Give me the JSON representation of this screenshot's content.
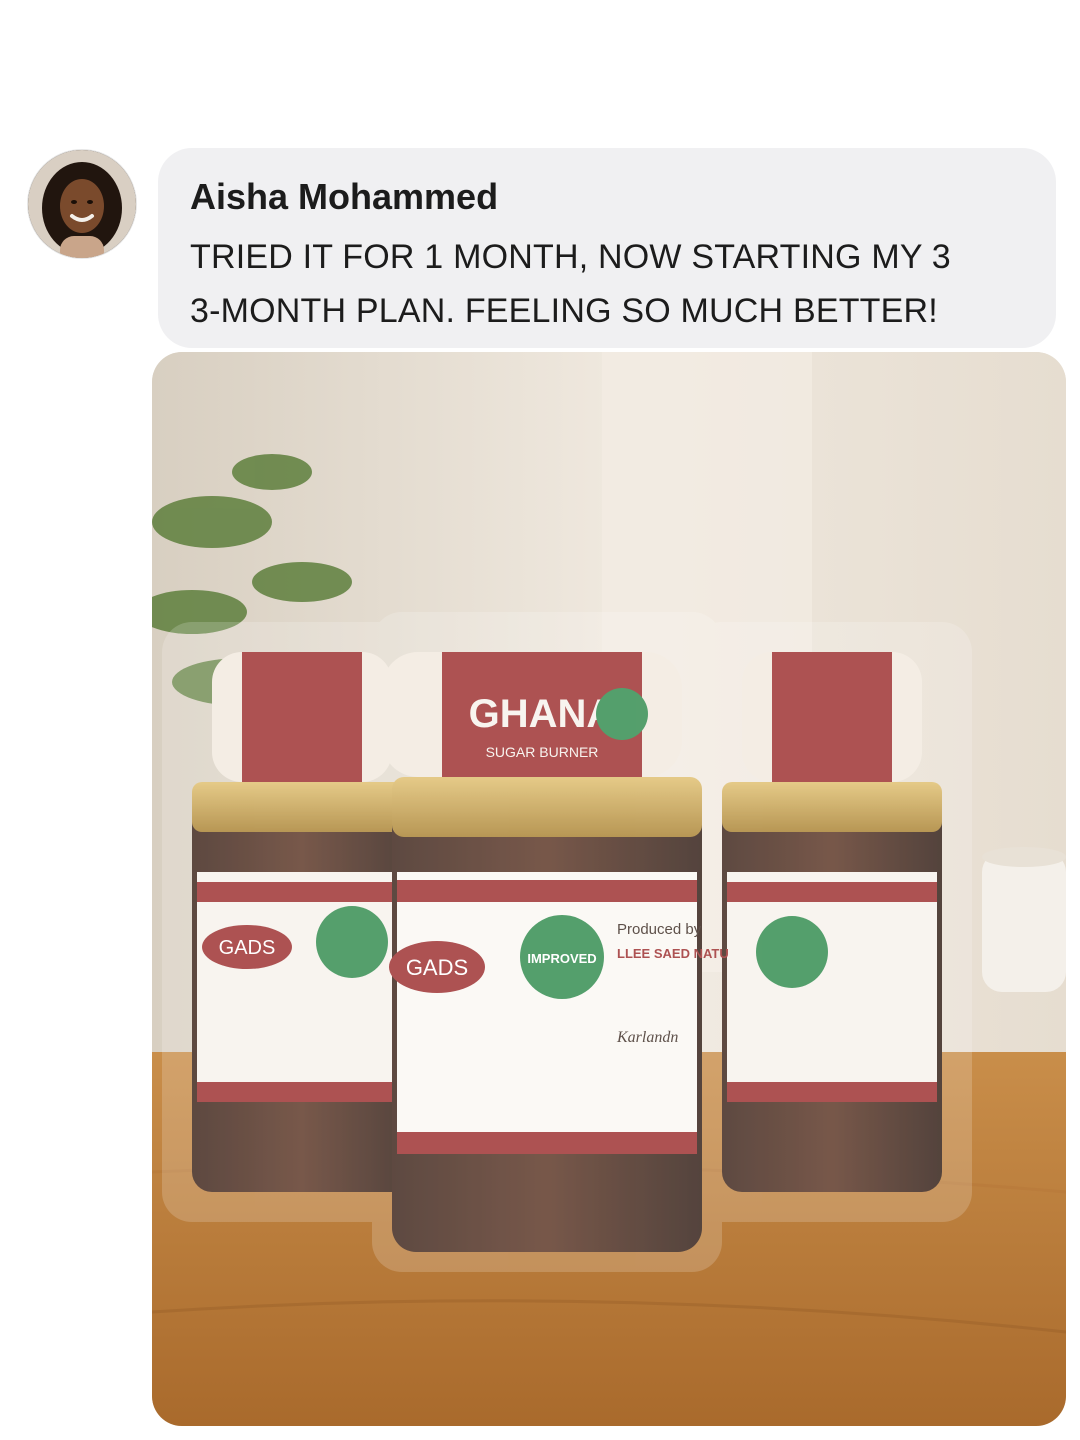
{
  "comment": {
    "author": "Aisha Mohammed",
    "message_lines": [
      "TRIED IT FOR 1 MONTH, NOW STARTING MY 3",
      "3-MONTH PLAN. FEELING SO MUCH BETTER!"
    ],
    "avatar_icon": "user-avatar-photo"
  },
  "attachment": {
    "icon": "product-photo",
    "jar_labels": {
      "cap_brand": "GHANA",
      "cap_sub": "SUGAR BURNER",
      "brand_badge": "GADS",
      "stamp": "IMPROVED",
      "produced_by": "Produced by",
      "producer": "LLEE SAED NATU",
      "label_line": "Karlandn"
    },
    "colors": {
      "label_red": "#9b2c2c",
      "stamp_green": "#2f8a4c",
      "lid_gold": "#c9a14a",
      "table_wood": "#b57b3c"
    }
  }
}
